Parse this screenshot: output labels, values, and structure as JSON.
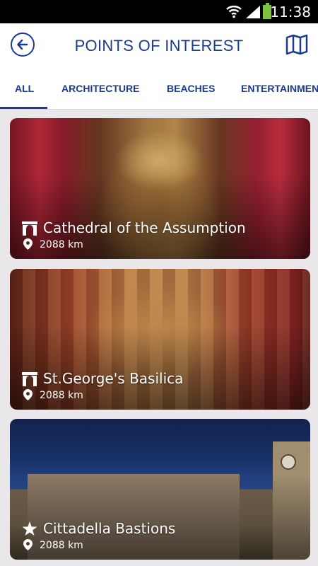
{
  "status_bar": {
    "time": "11:38"
  },
  "app_bar": {
    "title": "POINTS OF INTEREST"
  },
  "tabs": [
    {
      "label": "ALL",
      "selected": true
    },
    {
      "label": "ARCHITECTURE",
      "selected": false
    },
    {
      "label": "BEACHES",
      "selected": false
    },
    {
      "label": "ENTERTAINMENT",
      "selected": false
    }
  ],
  "cards": [
    {
      "title": "Cathedral of the Assumption",
      "distance": "2088 km",
      "category_icon": "architecture-icon"
    },
    {
      "title": "St.George's Basilica",
      "distance": "2088 km",
      "category_icon": "architecture-icon"
    },
    {
      "title": "Cittadella Bastions",
      "distance": "2088 km",
      "category_icon": "star-icon"
    }
  ],
  "colors": {
    "primary": "#1a3b8f",
    "background": "#e9e7e9",
    "battery": "#7cc142"
  }
}
